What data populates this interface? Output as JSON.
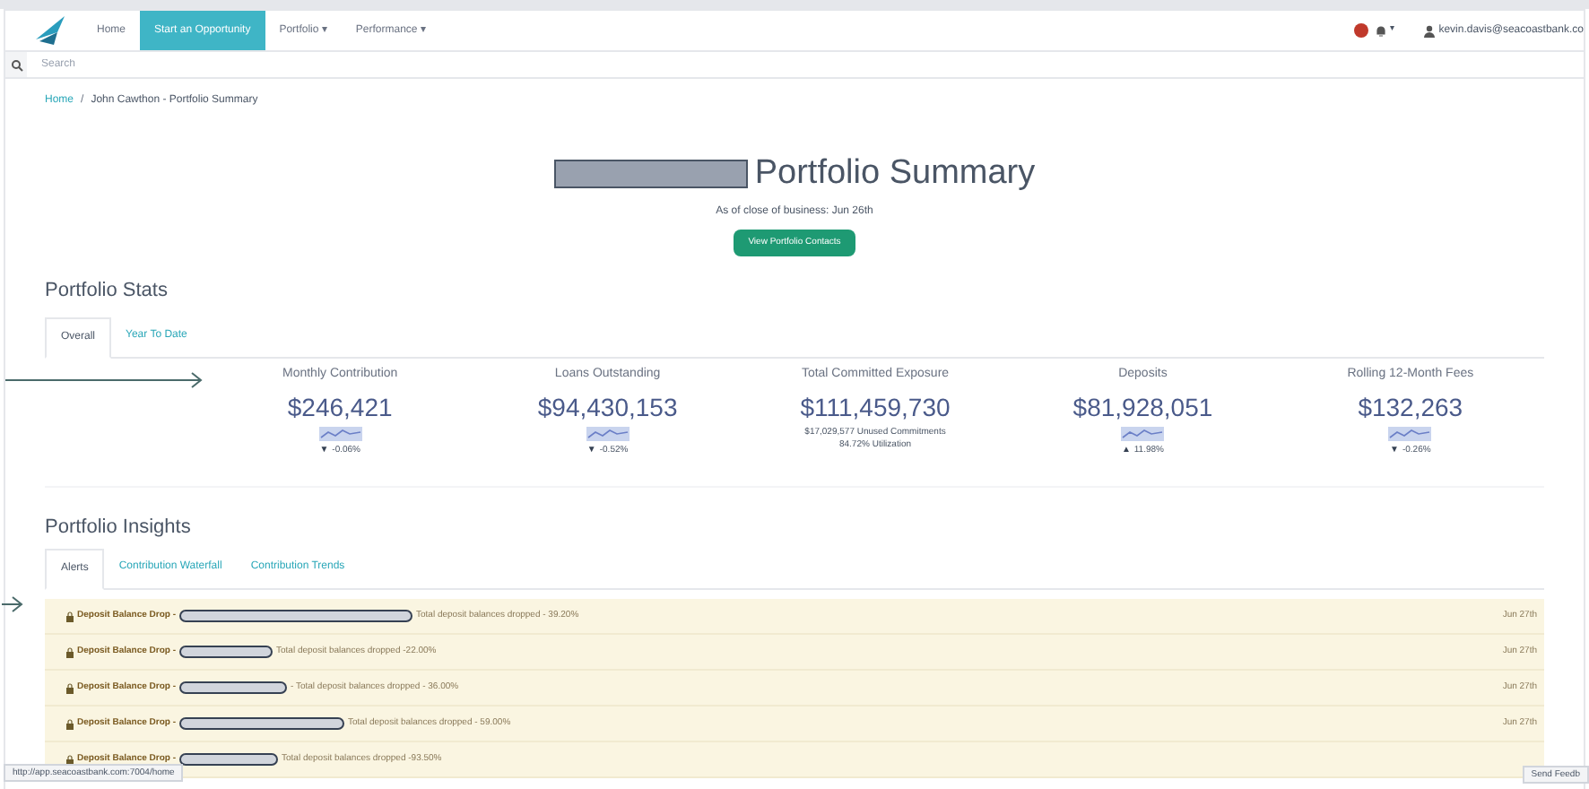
{
  "nav": {
    "items": [
      {
        "label": "Home",
        "selected": false
      },
      {
        "label": "Start an Opportunity",
        "selected": true
      },
      {
        "label": "Portfolio ▾",
        "selected": false
      },
      {
        "label": "Performance ▾",
        "selected": false
      }
    ],
    "alerts_caret": "▾",
    "user": "kevin.davis@seacoastbank.co"
  },
  "search": {
    "placeholder": "Search"
  },
  "breadcrumb": [
    "Home",
    "/",
    "John Cawthon - Portfolio Summary"
  ],
  "header": {
    "title": "Portfolio Summary",
    "subtitle": "As of close of business: Jun 26th",
    "button": "View Portfolio Contacts"
  },
  "stats": {
    "title": "Portfolio Stats",
    "tabs": [
      {
        "label": "Overall",
        "selected": true
      },
      {
        "label": "Year To Date",
        "selected": false
      }
    ],
    "items": [
      {
        "label": "Monthly Contribution",
        "value": "$246,421",
        "trend": "▼",
        "change": "-0.06%"
      },
      {
        "label": "Loans Outstanding",
        "value": "$94,430,153",
        "trend": "▼",
        "change": "-0.52%"
      },
      {
        "label": "Total Committed Exposure",
        "value": "$111,459,730",
        "notes": [
          "$17,029,577 Unused Commitments",
          "84.72% Utilization"
        ]
      },
      {
        "label": "Deposits",
        "value": "$81,928,051",
        "trend": "▲",
        "change": "11.98%"
      },
      {
        "label": "Rolling 12-Month Fees",
        "value": "$132,263",
        "trend": "▼",
        "change": "-0.26%"
      }
    ]
  },
  "insights": {
    "title": "Portfolio Insights",
    "tabs": [
      {
        "label": "Alerts",
        "selected": true
      },
      {
        "label": "Contribution Waterfall",
        "selected": false
      },
      {
        "label": "Contribution Trends",
        "selected": false
      }
    ],
    "alerts": [
      {
        "title": "Deposit Balance Drop -",
        "text": "Total deposit balances dropped - 39.20%",
        "date": "Jun 27th"
      },
      {
        "title": "Deposit Balance Drop -",
        "text": "Total deposit balances dropped -22.00%",
        "date": "Jun 27th"
      },
      {
        "title": "Deposit Balance Drop -",
        "text": "- Total deposit balances dropped - 36.00%",
        "date": "Jun 27th"
      },
      {
        "title": "Deposit Balance Drop -",
        "text": "Total deposit balances dropped - 59.00%",
        "date": "Jun 27th"
      },
      {
        "title": "Deposit Balance Drop -",
        "text": "Total deposit balances dropped -93.50%"
      }
    ]
  },
  "status_bar": {
    "url": "http://app.seacoastbank.com:7004/home"
  },
  "feedback_button": "Send Feedb"
}
